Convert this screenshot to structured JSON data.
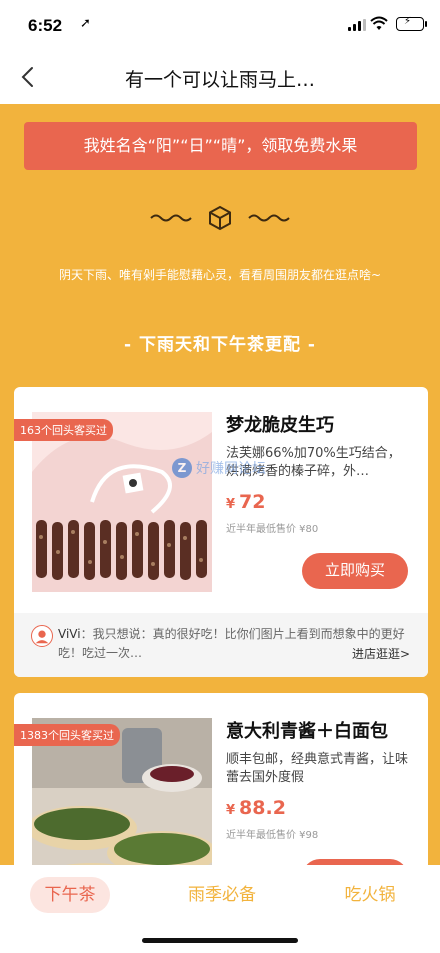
{
  "status_bar": {
    "time": "6:52"
  },
  "nav": {
    "title": "有一个可以让雨马上…"
  },
  "banner": {
    "text": "我姓名含“阳”“日”“晴”，领取免费水果"
  },
  "tagline": "阴天下雨、唯有剁手能慰藉心灵，看看周围朋友都在逛点啥~",
  "section_title": "- 下雨天和下午茶更配 -",
  "watermark": {
    "letter": "Z",
    "text": "好赚网论坛"
  },
  "products": [
    {
      "badge": "163个回头客买过",
      "name": "梦龙脆皮生巧",
      "desc": "法芙娜66%加70%生巧结合，烘满烤香的榛子碎，外…",
      "currency": "¥",
      "price": "72",
      "lowest": "近半年最低售价 ¥80",
      "buy_label": "立即购买",
      "review": {
        "name": "ViVi",
        "text": "：我只想说：真的很好吃！比你们图片上看到而想象中的更好吃！吃过一次…",
        "shop_link": "进店逛逛>"
      }
    },
    {
      "badge": "1383个回头客买过",
      "name": "意大利青酱＋白面包",
      "desc": "顺丰包邮，经典意式青酱，让味蕾去国外度假",
      "currency": "¥",
      "price": "88.2",
      "lowest": "近半年最低售价 ¥98"
    }
  ],
  "tabs": [
    {
      "label": "下午茶",
      "active": true
    },
    {
      "label": "雨季必备",
      "active": false
    },
    {
      "label": "吃火锅",
      "active": false
    }
  ],
  "colors": {
    "page_bg": "#F2B33D",
    "accent": "#E9664F"
  }
}
